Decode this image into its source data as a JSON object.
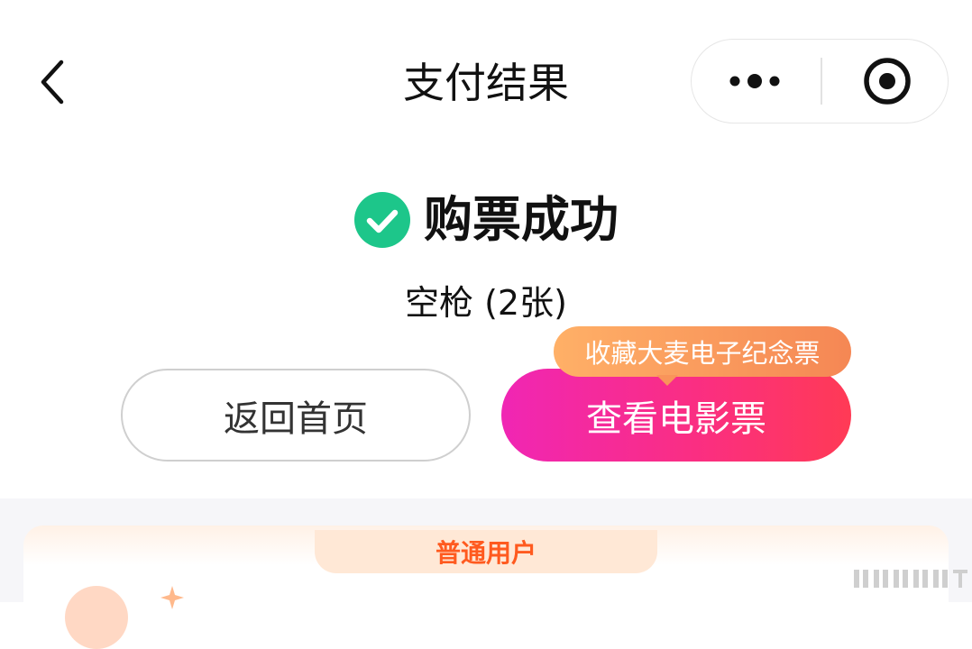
{
  "header": {
    "title": "支付结果"
  },
  "status": {
    "text": "购票成功",
    "color": "#1dc68a"
  },
  "order": {
    "movie_line": "空枪 (2张)"
  },
  "actions": {
    "home_label": "返回首页",
    "ticket_label": "查看电影票",
    "ticket_tip": "收藏大麦电子纪念票"
  },
  "member": {
    "tab_label": "普通用户"
  },
  "colors": {
    "accent": "#fb2f7e",
    "tip": "#f58754",
    "member": "#ff5a1f"
  },
  "icons": {
    "back": "chevron-left-icon",
    "more": "more-dots-icon",
    "close": "target-circle-icon",
    "status": "check-circle-icon"
  }
}
